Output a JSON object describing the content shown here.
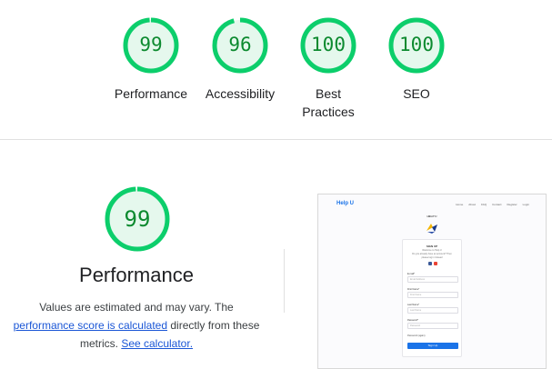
{
  "categories": [
    {
      "score": "99",
      "label_lines": [
        "Performance"
      ],
      "fraction": 0.99,
      "name": "performance"
    },
    {
      "score": "96",
      "label_lines": [
        "Accessibility"
      ],
      "fraction": 0.96,
      "name": "accessibility"
    },
    {
      "score": "100",
      "label_lines": [
        "Best",
        "Practices"
      ],
      "fraction": 1.0,
      "name": "best-practices"
    },
    {
      "score": "100",
      "label_lines": [
        "SEO"
      ],
      "fraction": 1.0,
      "name": "seo"
    }
  ],
  "performance": {
    "score": "99",
    "fraction": 0.99,
    "title": "Performance",
    "desc_prefix": "Values are estimated and may vary. The",
    "link_score": "performance score is calculated",
    "desc_mid": "directly from these metrics.",
    "link_calculator": "See calculator."
  },
  "screenshot": {
    "brand": "Help U",
    "nav_links": [
      "Home",
      "About",
      "FAQ",
      "Contact",
      "Register",
      "Login"
    ],
    "heading": "HELP U",
    "card_title": "SIGN UP",
    "card_sub_1": "Welcome to Help U",
    "card_sub_2": "Do you already have an account? Then",
    "card_sub_3": "please log in instead",
    "fields": [
      {
        "label": "E-mail*",
        "placeholder": "Email Address"
      },
      {
        "label": "First Name*",
        "placeholder": "First Name"
      },
      {
        "label": "Last Name*",
        "placeholder": "Last Name"
      },
      {
        "label": "Password*",
        "placeholder": "Password"
      }
    ],
    "remember": "Password (again)",
    "button": "Sign Up"
  },
  "colors": {
    "pass_ring": "#0cce6b",
    "pass_fill": "#e5f8ed",
    "pass_text": "#0c8a2f",
    "link": "#1a56d6"
  }
}
